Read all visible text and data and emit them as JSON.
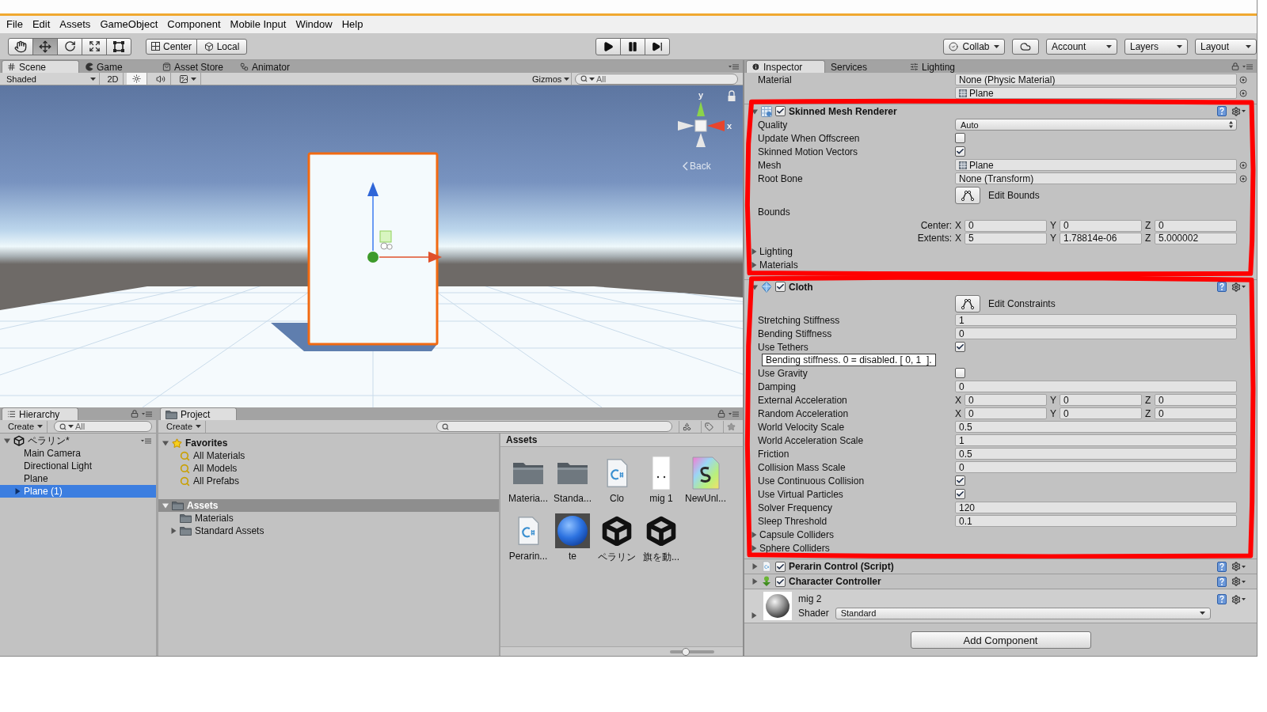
{
  "menu_bar": [
    "File",
    "Edit",
    "Assets",
    "GameObject",
    "Component",
    "Mobile Input",
    "Window",
    "Help"
  ],
  "toolbar": {
    "tools": [
      {
        "kind": "hand",
        "selected": false
      },
      {
        "kind": "move",
        "selected": true
      },
      {
        "kind": "rotate",
        "selected": false
      },
      {
        "kind": "scale",
        "selected": false
      },
      {
        "kind": "rect",
        "selected": false
      }
    ],
    "pivot_buttons": [
      {
        "kind": "pivot",
        "label": "Center"
      },
      {
        "kind": "space",
        "label": "Local"
      }
    ],
    "playback": [
      {
        "kind": "play"
      },
      {
        "kind": "pause"
      },
      {
        "kind": "step"
      }
    ],
    "collab": "Collab",
    "account": "Account",
    "layers": "Layers",
    "layout": "Layout"
  },
  "scene_panel": {
    "tabs": [
      {
        "kind": "scene",
        "label": "Scene",
        "selected": true
      },
      {
        "kind": "game",
        "label": "Game",
        "selected": false
      },
      {
        "kind": "store",
        "label": "Asset Store",
        "selected": false
      },
      {
        "kind": "animator",
        "label": "Animator",
        "selected": false
      }
    ],
    "toolbar": {
      "shading": "Shaded",
      "mode_2d": {
        "label": "2D",
        "on": false
      },
      "toggles": [
        {
          "kind": "lighting",
          "on": true
        },
        {
          "kind": "audio",
          "on": false
        },
        {
          "kind": "effects",
          "on": false
        }
      ],
      "gizmos": "Gizmos",
      "search": {
        "placeholder": "All"
      }
    },
    "orientation_gizmo": {
      "up_label": "y",
      "right_label": "x",
      "view_label": "Back"
    }
  },
  "inspector": {
    "tabs": [
      {
        "kind": "inspector",
        "label": "Inspector",
        "selected": true
      },
      {
        "kind": "services",
        "label": "Services",
        "selected": false
      },
      {
        "kind": "lighting",
        "label": "Lighting",
        "selected": false
      }
    ],
    "top_rows": [
      {
        "kind": "object",
        "label": "Material",
        "value": "None (Physic Material)",
        "asset_icon": false
      },
      {
        "kind": "object",
        "value": "Plane",
        "asset_icon": true
      }
    ],
    "components": [
      {
        "kind": "skinned_mesh_renderer",
        "name": "Skinned Mesh Renderer",
        "expanded": true,
        "enabled": true,
        "highlighted": true,
        "properties": [
          {
            "kind": "dropdown",
            "label": "Quality",
            "value": "Auto"
          },
          {
            "kind": "toggle",
            "label": "Update When Offscreen",
            "checked": false
          },
          {
            "kind": "toggle",
            "label": "Skinned Motion Vectors",
            "checked": true
          },
          {
            "kind": "object",
            "label": "Mesh",
            "value": "Plane",
            "asset_icon": true
          },
          {
            "kind": "object",
            "label": "Root Bone",
            "value": "None (Transform)",
            "asset_icon": false
          },
          {
            "kind": "edit_button",
            "label": "Edit Bounds"
          },
          {
            "kind": "heading",
            "label": "Bounds"
          },
          {
            "kind": "bounds_vector",
            "label": "Center:",
            "fields": [
              {
                "axis": "X",
                "value": "0"
              },
              {
                "axis": "Y",
                "value": "0"
              },
              {
                "axis": "Z",
                "value": "0"
              }
            ]
          },
          {
            "kind": "bounds_vector",
            "label": "Extents:",
            "fields": [
              {
                "axis": "X",
                "value": "5"
              },
              {
                "axis": "Y",
                "value": "1.78814e-06"
              },
              {
                "axis": "Z",
                "value": "5.000002"
              }
            ]
          },
          {
            "kind": "foldout",
            "label": "Lighting",
            "expanded": false
          },
          {
            "kind": "foldout",
            "label": "Materials",
            "expanded": false
          }
        ]
      },
      {
        "kind": "cloth",
        "name": "Cloth",
        "expanded": true,
        "enabled": true,
        "highlighted": true,
        "properties": [
          {
            "kind": "edit_button",
            "label": "Edit Constraints"
          },
          {
            "kind": "number",
            "label": "Stretching Stiffness",
            "value": "1"
          },
          {
            "kind": "number",
            "label": "Bending Stiffness",
            "value": "0"
          },
          {
            "kind": "toggle",
            "label": "Use Tethers",
            "checked": true
          },
          {
            "kind": "tooltip",
            "text": "Bending stiffness. 0 = disabled. [ 0, 1  ]."
          },
          {
            "kind": "toggle",
            "label": "Use Gravity",
            "checked": false
          },
          {
            "kind": "number",
            "label": "Damping",
            "value": "0"
          },
          {
            "kind": "vector",
            "label": "External Acceleration",
            "fields": [
              {
                "axis": "X",
                "value": "0"
              },
              {
                "axis": "Y",
                "value": "0"
              },
              {
                "axis": "Z",
                "value": "0"
              }
            ]
          },
          {
            "kind": "vector",
            "label": "Random Acceleration",
            "fields": [
              {
                "axis": "X",
                "value": "0"
              },
              {
                "axis": "Y",
                "value": "0"
              },
              {
                "axis": "Z",
                "value": "0"
              }
            ]
          },
          {
            "kind": "number",
            "label": "World Velocity Scale",
            "value": "0.5"
          },
          {
            "kind": "number",
            "label": "World Acceleration Scale",
            "value": "1"
          },
          {
            "kind": "number",
            "label": "Friction",
            "value": "0.5"
          },
          {
            "kind": "number",
            "label": "Collision Mass Scale",
            "value": "0"
          },
          {
            "kind": "toggle",
            "label": "Use Continuous Collision",
            "checked": true
          },
          {
            "kind": "toggle",
            "label": "Use Virtual Particles",
            "checked": true
          },
          {
            "kind": "number",
            "label": "Solver Frequency",
            "value": "120"
          },
          {
            "kind": "number",
            "label": "Sleep Threshold",
            "value": "0.1"
          },
          {
            "kind": "foldout",
            "label": "Capsule Colliders",
            "expanded": false
          },
          {
            "kind": "foldout",
            "label": "Sphere Colliders",
            "expanded": false
          }
        ]
      },
      {
        "kind": "script",
        "name": "Perarin Control (Script)",
        "expanded": false,
        "enabled": true,
        "highlighted": false
      },
      {
        "kind": "character_controller",
        "name": "Character Controller",
        "expanded": false,
        "enabled": true,
        "highlighted": false
      }
    ],
    "material": {
      "name": "mig 2",
      "shader_label": "Shader",
      "shader": "Standard",
      "expanded": false
    },
    "add_component": "Add Component"
  },
  "hierarchy": {
    "tabs": [
      {
        "label": "Hierarchy",
        "selected": true
      }
    ],
    "create": "Create",
    "search": {
      "placeholder": "All"
    },
    "scene": {
      "name": "ペラリン*",
      "expanded": true,
      "children": [
        {
          "name": "Main Camera",
          "selected": false,
          "has_children": false
        },
        {
          "name": "Directional Light",
          "selected": false,
          "has_children": false
        },
        {
          "name": "Plane",
          "selected": false,
          "has_children": false
        },
        {
          "name": "Plane (1)",
          "selected": true,
          "has_children": true
        }
      ]
    }
  },
  "project": {
    "tabs": [
      {
        "label": "Project",
        "selected": true
      }
    ],
    "create": "Create",
    "tree": [
      {
        "kind": "favorites",
        "label": "Favorites",
        "expanded": true,
        "selected": false,
        "children": [
          {
            "kind": "saved_search",
            "label": "All Materials",
            "selected": false,
            "has_children": false
          },
          {
            "kind": "saved_search",
            "label": "All Models",
            "selected": false,
            "has_children": false
          },
          {
            "kind": "saved_search",
            "label": "All Prefabs",
            "selected": false,
            "has_children": false
          }
        ]
      },
      {
        "kind": "folder",
        "label": "Assets",
        "expanded": true,
        "selected": true,
        "children": [
          {
            "kind": "folder",
            "label": "Materials",
            "selected": false,
            "has_children": false
          },
          {
            "kind": "folder",
            "label": "Standard Assets",
            "selected": false,
            "has_children": true
          }
        ]
      }
    ],
    "breadcrumb": "Assets",
    "assets": [
      {
        "kind": "folder",
        "name": "Materia..."
      },
      {
        "kind": "folder",
        "name": "Standa..."
      },
      {
        "kind": "script",
        "name": "Clo"
      },
      {
        "kind": "blank",
        "name": "mig 1"
      },
      {
        "kind": "shader",
        "name": "NewUnl..."
      },
      {
        "kind": "script",
        "name": "Perarin..."
      },
      {
        "kind": "material",
        "name": "te"
      },
      {
        "kind": "scene",
        "name": "ペラリン"
      },
      {
        "kind": "scene",
        "name": "旗を動..."
      }
    ],
    "icon_size": {
      "level": 0.35
    }
  }
}
